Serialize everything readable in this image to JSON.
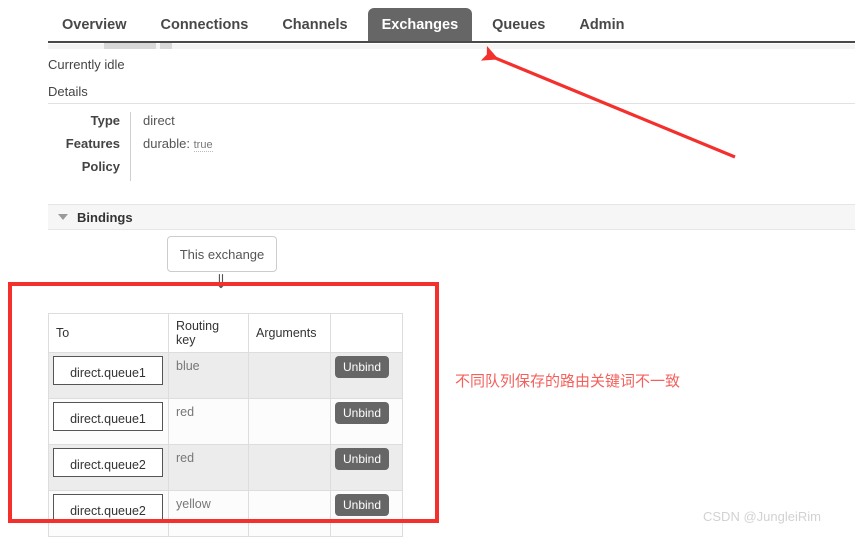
{
  "nav": {
    "tabs": [
      {
        "label": "Overview",
        "active": false
      },
      {
        "label": "Connections",
        "active": false
      },
      {
        "label": "Channels",
        "active": false
      },
      {
        "label": "Exchanges",
        "active": true
      },
      {
        "label": "Queues",
        "active": false
      },
      {
        "label": "Admin",
        "active": false
      }
    ]
  },
  "status": {
    "idle_text": "Currently idle"
  },
  "details": {
    "heading": "Details",
    "rows": [
      {
        "label": "Type",
        "value": "direct"
      },
      {
        "label": "Features",
        "key": "durable:",
        "value": "true"
      },
      {
        "label": "Policy",
        "value": ""
      }
    ]
  },
  "bindings": {
    "title": "Bindings",
    "source_label": "This exchange",
    "flow_arrow": "⇓",
    "columns": [
      "To",
      "Routing key",
      "Arguments",
      ""
    ],
    "rows": [
      {
        "to": "direct.queue1",
        "routing_key": "blue",
        "arguments": "",
        "action": "Unbind"
      },
      {
        "to": "direct.queue1",
        "routing_key": "red",
        "arguments": "",
        "action": "Unbind"
      },
      {
        "to": "direct.queue2",
        "routing_key": "red",
        "arguments": "",
        "action": "Unbind"
      },
      {
        "to": "direct.queue2",
        "routing_key": "yellow",
        "arguments": "",
        "action": "Unbind"
      }
    ]
  },
  "annotations": {
    "note_text": "不同队列保存的路由关键词不一致",
    "highlight_color": "#f4302c",
    "note_color": "#f4605c",
    "watermark": "CSDN @JungleiRim"
  }
}
